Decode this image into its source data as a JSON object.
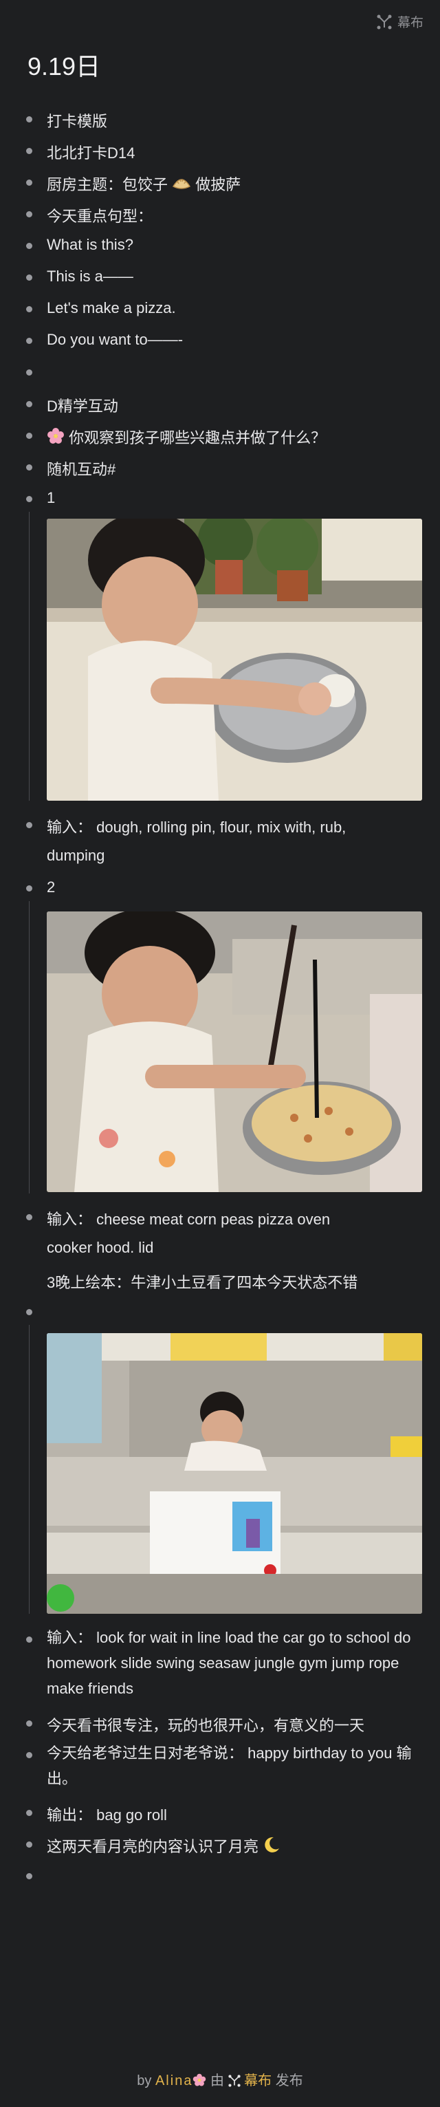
{
  "brand": {
    "name": "幕布"
  },
  "page_title": "9.19日",
  "items": [
    "打卡模版",
    "北北打卡D14",
    "厨房主题：包饺子",
    "做披萨",
    "今天重点句型：",
    "What is this?",
    "This is a——",
    "Let's make a pizza.",
    "Do you want to——-",
    "",
    "D精学互动",
    "你观察到孩子哪些兴趣点并做了什么？",
    "随机互动#",
    "1",
    "输入：  dough, rolling pin, flour, mix  with, rub,",
    "dumping",
    "2",
    "输入：  cheese meat corn peas pizza oven",
    "cooker hood. lid",
    "3晚上绘本：牛津小土豆看了四本今天状态不错",
    "",
    "输入：  look for wait in line load the car  go to school do homework slide swing seasaw jungle gym jump rope  make friends",
    "今天看书很专注，玩的也很开心，有意义的一天",
    "今天给老爷过生日对老爷说：  happy birthday to you 输出。",
    "输出：  bag  go roll",
    "这两天看月亮的内容认识了月亮",
    ""
  ],
  "footer": {
    "by": "by",
    "author": "Alina",
    "via": "由",
    "brand": "幕布",
    "publish": "发布"
  }
}
